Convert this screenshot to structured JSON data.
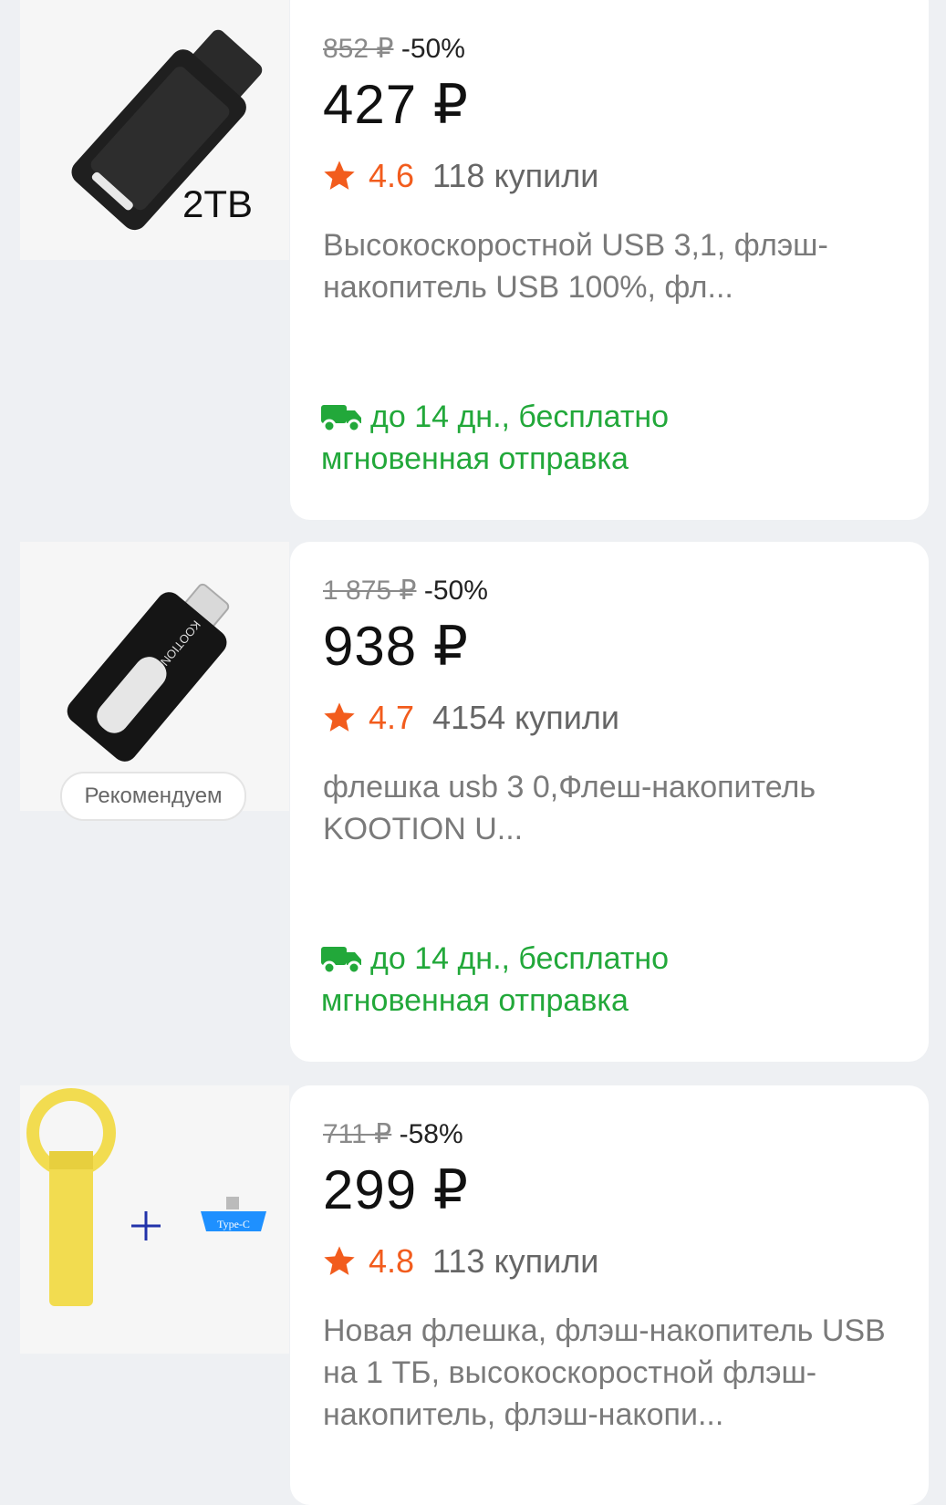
{
  "products": [
    {
      "old_price": "852 ₽",
      "discount": "-50%",
      "price": "427 ₽",
      "rating": "4.6",
      "bought": "118 купили",
      "title": "Высокоскоростной USB 3,1, флэш-накопитель USB 100%, фл...",
      "delivery_line1": "до 14 дн., бесплатно",
      "delivery_line2": "мгновенная отправка",
      "image_label": "2TB"
    },
    {
      "old_price": "1 875 ₽",
      "discount": "-50%",
      "price": "938 ₽",
      "rating": "4.7",
      "bought": "4154 купили",
      "title": "флешка usb 3 0,Флеш-накопитель KOOTION U...",
      "delivery_line1": "до 14 дн., бесплатно",
      "delivery_line2": "мгновенная отправка",
      "badge": "Рекомендуем",
      "brand": "KOOTION"
    },
    {
      "old_price": "711 ₽",
      "discount": "-58%",
      "price": "299 ₽",
      "rating": "4.8",
      "bought": "113 купили",
      "title": "Новая флешка, флэш-накопитель USB на 1 ТБ, высокоскоростной флэш-накопитель, флэш-накопи...",
      "image_adapter_label": "Type-C"
    }
  ],
  "colors": {
    "rating": "#f25c1d",
    "delivery": "#22a83a",
    "background": "#eef0f3"
  },
  "icons": {
    "rating": "star-icon",
    "delivery": "truck-icon"
  }
}
